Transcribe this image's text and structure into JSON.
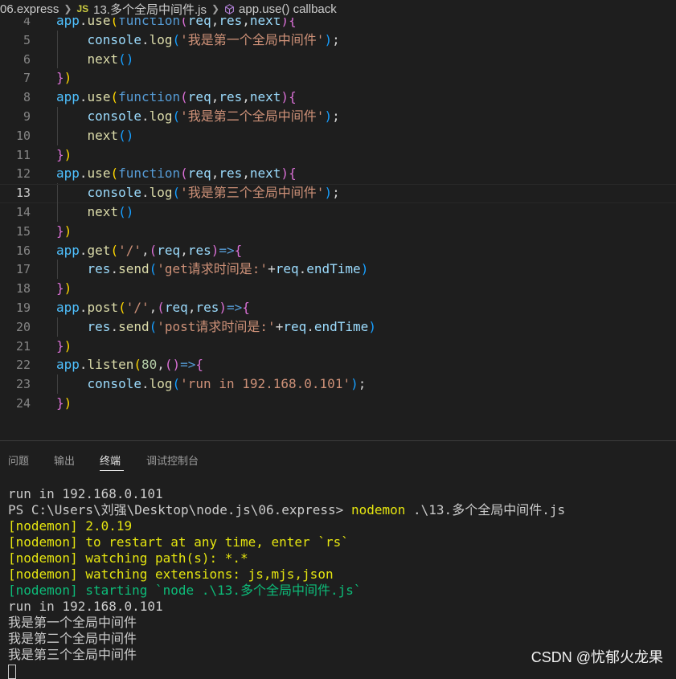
{
  "breadcrumb": {
    "folder": "06.express",
    "file_badge": "JS",
    "file": "13.多个全局中间件.js",
    "symbol": "app.use() callback"
  },
  "editor": {
    "active_line": 13,
    "lines": [
      {
        "n": "4",
        "tokens": [
          [
            "app",
            "id"
          ],
          [
            ".",
            "pun"
          ],
          [
            "use",
            "fn"
          ],
          [
            "(",
            "b1"
          ],
          [
            "function",
            "kw"
          ],
          [
            "(",
            "b2"
          ],
          [
            "req",
            "var"
          ],
          [
            ",",
            "pun"
          ],
          [
            "res",
            "var"
          ],
          [
            ",",
            "pun"
          ],
          [
            "next",
            "var"
          ],
          [
            ")",
            "b2"
          ],
          [
            "{",
            "b2"
          ]
        ]
      },
      {
        "n": "5",
        "indent": true,
        "tokens": [
          [
            "    console",
            "var"
          ],
          [
            ".",
            "pun"
          ],
          [
            "log",
            "fn"
          ],
          [
            "(",
            "b3"
          ],
          [
            "'我是第一个全局中间件'",
            "str"
          ],
          [
            ")",
            "b3"
          ],
          [
            ";",
            "pun"
          ]
        ]
      },
      {
        "n": "6",
        "indent": true,
        "tokens": [
          [
            "    next",
            "fn"
          ],
          [
            "()",
            "b3"
          ]
        ]
      },
      {
        "n": "7",
        "tokens": [
          [
            "}",
            "b2"
          ],
          [
            ")",
            "b1"
          ]
        ]
      },
      {
        "n": "8",
        "tokens": [
          [
            "app",
            "id"
          ],
          [
            ".",
            "pun"
          ],
          [
            "use",
            "fn"
          ],
          [
            "(",
            "b1"
          ],
          [
            "function",
            "kw"
          ],
          [
            "(",
            "b2"
          ],
          [
            "req",
            "var"
          ],
          [
            ",",
            "pun"
          ],
          [
            "res",
            "var"
          ],
          [
            ",",
            "pun"
          ],
          [
            "next",
            "var"
          ],
          [
            ")",
            "b2"
          ],
          [
            "{",
            "b2"
          ]
        ]
      },
      {
        "n": "9",
        "indent": true,
        "tokens": [
          [
            "    console",
            "var"
          ],
          [
            ".",
            "pun"
          ],
          [
            "log",
            "fn"
          ],
          [
            "(",
            "b3"
          ],
          [
            "'我是第二个全局中间件'",
            "str"
          ],
          [
            ")",
            "b3"
          ],
          [
            ";",
            "pun"
          ]
        ]
      },
      {
        "n": "10",
        "indent": true,
        "tokens": [
          [
            "    next",
            "fn"
          ],
          [
            "()",
            "b3"
          ]
        ]
      },
      {
        "n": "11",
        "tokens": [
          [
            "}",
            "b2"
          ],
          [
            ")",
            "b1"
          ]
        ]
      },
      {
        "n": "12",
        "tokens": [
          [
            "app",
            "id"
          ],
          [
            ".",
            "pun"
          ],
          [
            "use",
            "fn"
          ],
          [
            "(",
            "b1"
          ],
          [
            "function",
            "kw"
          ],
          [
            "(",
            "b2"
          ],
          [
            "req",
            "var"
          ],
          [
            ",",
            "pun"
          ],
          [
            "res",
            "var"
          ],
          [
            ",",
            "pun"
          ],
          [
            "next",
            "var"
          ],
          [
            ")",
            "b2"
          ],
          [
            "{",
            "b2"
          ]
        ]
      },
      {
        "n": "13",
        "indent": true,
        "tokens": [
          [
            "    console",
            "var"
          ],
          [
            ".",
            "pun"
          ],
          [
            "log",
            "fn"
          ],
          [
            "(",
            "b3"
          ],
          [
            "'我是第三个全局中间件'",
            "str"
          ],
          [
            ")",
            "b3"
          ],
          [
            ";",
            "pun"
          ]
        ]
      },
      {
        "n": "14",
        "indent": true,
        "tokens": [
          [
            "    next",
            "fn"
          ],
          [
            "()",
            "b3"
          ]
        ]
      },
      {
        "n": "15",
        "tokens": [
          [
            "}",
            "b2"
          ],
          [
            ")",
            "b1"
          ]
        ]
      },
      {
        "n": "16",
        "tokens": [
          [
            "app",
            "id"
          ],
          [
            ".",
            "pun"
          ],
          [
            "get",
            "fn"
          ],
          [
            "(",
            "b1"
          ],
          [
            "'/'",
            "str"
          ],
          [
            ",",
            "pun"
          ],
          [
            "(",
            "b2"
          ],
          [
            "req",
            "var"
          ],
          [
            ",",
            "pun"
          ],
          [
            "res",
            "var"
          ],
          [
            ")",
            "b2"
          ],
          [
            "=>",
            "kw"
          ],
          [
            "{",
            "b2"
          ]
        ]
      },
      {
        "n": "17",
        "indent": true,
        "tokens": [
          [
            "    res",
            "var"
          ],
          [
            ".",
            "pun"
          ],
          [
            "send",
            "fn"
          ],
          [
            "(",
            "b3"
          ],
          [
            "'get请求时间是:'",
            "str"
          ],
          [
            "+",
            "pun"
          ],
          [
            "req",
            "var"
          ],
          [
            ".",
            "pun"
          ],
          [
            "endTime",
            "var"
          ],
          [
            ")",
            "b3"
          ]
        ]
      },
      {
        "n": "18",
        "tokens": [
          [
            "}",
            "b2"
          ],
          [
            ")",
            "b1"
          ]
        ]
      },
      {
        "n": "19",
        "tokens": [
          [
            "app",
            "id"
          ],
          [
            ".",
            "pun"
          ],
          [
            "post",
            "fn"
          ],
          [
            "(",
            "b1"
          ],
          [
            "'/'",
            "str"
          ],
          [
            ",",
            "pun"
          ],
          [
            "(",
            "b2"
          ],
          [
            "req",
            "var"
          ],
          [
            ",",
            "pun"
          ],
          [
            "res",
            "var"
          ],
          [
            ")",
            "b2"
          ],
          [
            "=>",
            "kw"
          ],
          [
            "{",
            "b2"
          ]
        ]
      },
      {
        "n": "20",
        "indent": true,
        "tokens": [
          [
            "    res",
            "var"
          ],
          [
            ".",
            "pun"
          ],
          [
            "send",
            "fn"
          ],
          [
            "(",
            "b3"
          ],
          [
            "'post请求时间是:'",
            "str"
          ],
          [
            "+",
            "pun"
          ],
          [
            "req",
            "var"
          ],
          [
            ".",
            "pun"
          ],
          [
            "endTime",
            "var"
          ],
          [
            ")",
            "b3"
          ]
        ]
      },
      {
        "n": "21",
        "tokens": [
          [
            "}",
            "b2"
          ],
          [
            ")",
            "b1"
          ]
        ]
      },
      {
        "n": "22",
        "tokens": [
          [
            "app",
            "id"
          ],
          [
            ".",
            "pun"
          ],
          [
            "listen",
            "fn"
          ],
          [
            "(",
            "b1"
          ],
          [
            "80",
            "num"
          ],
          [
            ",",
            "pun"
          ],
          [
            "()",
            "b2"
          ],
          [
            "=>",
            "kw"
          ],
          [
            "{",
            "b2"
          ]
        ]
      },
      {
        "n": "23",
        "indent": true,
        "tokens": [
          [
            "    console",
            "var"
          ],
          [
            ".",
            "pun"
          ],
          [
            "log",
            "fn"
          ],
          [
            "(",
            "b3"
          ],
          [
            "'run in 192.168.0.101'",
            "str"
          ],
          [
            ")",
            "b3"
          ],
          [
            ";",
            "pun"
          ]
        ]
      },
      {
        "n": "24",
        "tokens": [
          [
            "}",
            "b2"
          ],
          [
            ")",
            "b1"
          ]
        ]
      }
    ]
  },
  "panel": {
    "tabs": [
      {
        "label": "问题"
      },
      {
        "label": "输出"
      },
      {
        "label": "终端"
      },
      {
        "label": "调试控制台"
      }
    ],
    "active_tab": "终端"
  },
  "terminal": {
    "lines": [
      {
        "text": "run in 192.168.0.101",
        "color": "default"
      },
      {
        "prompt": "PS C:\\Users\\刘强\\Desktop\\node.js\\06.express> ",
        "cmd": "nodemon",
        "args": " .\\13.多个全局中间件.js"
      },
      {
        "text": "[nodemon] 2.0.19",
        "color": "yellow"
      },
      {
        "text": "[nodemon] to restart at any time, enter `rs`",
        "color": "yellow"
      },
      {
        "text": "[nodemon] watching path(s): *.*",
        "color": "yellow"
      },
      {
        "text": "[nodemon] watching extensions: js,mjs,json",
        "color": "yellow"
      },
      {
        "text": "[nodemon] starting `node .\\13.多个全局中间件.js`",
        "color": "green"
      },
      {
        "text": "run in 192.168.0.101",
        "color": "default"
      },
      {
        "text": "我是第一个全局中间件",
        "color": "default"
      },
      {
        "text": "我是第二个全局中间件",
        "color": "default"
      },
      {
        "text": "我是第三个全局中间件",
        "color": "default"
      }
    ]
  },
  "watermark": "CSDN @忧郁火龙果",
  "colors": {
    "background": "#1e1e1e",
    "string": "#ce9178",
    "function": "#dcdcaa",
    "keyword": "#569cd6",
    "variable": "#9cdcfe",
    "nodemon_yellow": "#e5e510",
    "nodemon_green": "#0dbc79"
  }
}
